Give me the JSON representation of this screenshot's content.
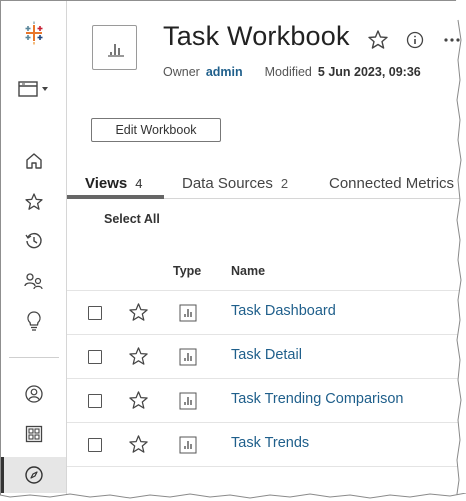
{
  "rail": {
    "items": [
      {
        "name": "home"
      },
      {
        "name": "favorites"
      },
      {
        "name": "recents"
      },
      {
        "name": "shared-with-me"
      },
      {
        "name": "recommendations"
      },
      {
        "name": "personal-space"
      },
      {
        "name": "collections"
      },
      {
        "name": "explore"
      }
    ]
  },
  "header": {
    "title": "Task Workbook",
    "owner_label": "Owner",
    "owner_value": "admin",
    "modified_label": "Modified",
    "modified_value": "5 Jun 2023, 09:36",
    "edit_label": "Edit Workbook"
  },
  "tabs": [
    {
      "label": "Views",
      "count": "4"
    },
    {
      "label": "Data Sources",
      "count": "2"
    },
    {
      "label": "Connected Metrics",
      "count": ""
    }
  ],
  "toolbar": {
    "select_all": "Select All"
  },
  "table": {
    "columns": {
      "type": "Type",
      "name": "Name"
    },
    "rows": [
      {
        "name": "Task Dashboard"
      },
      {
        "name": "Task Detail"
      },
      {
        "name": "Task Trending Comparison"
      },
      {
        "name": "Task Trends"
      }
    ]
  },
  "colors": {
    "link": "#1f5f8b",
    "text": "#333333",
    "border": "#d6d6d6"
  }
}
